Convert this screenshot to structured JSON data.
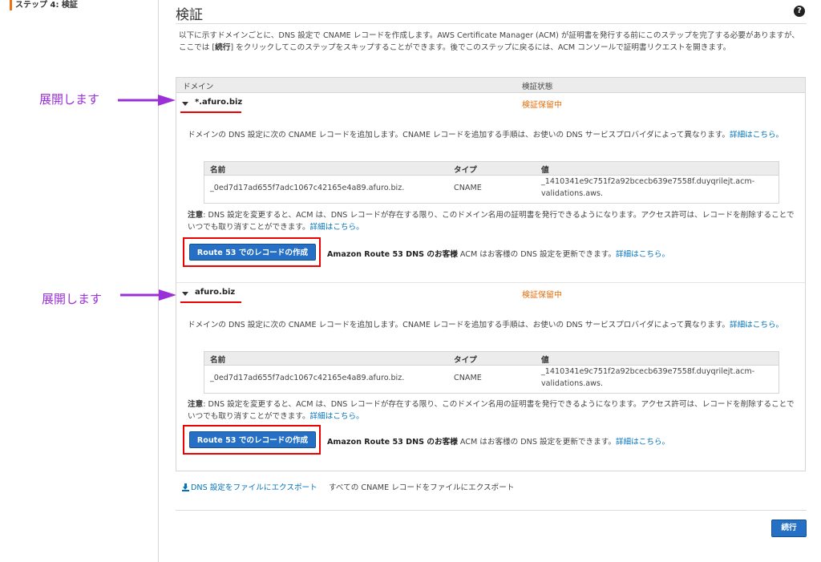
{
  "sidebar": {
    "step_label": "ステップ 4: 検証"
  },
  "header": {
    "title": "検証",
    "help_icon": "?"
  },
  "description": {
    "part1": "以下に示すドメインごとに、DNS 設定で CNAME レコードを作成します。AWS Certificate Manager (ACM) が証明書を発行する前にこのステップを完了する必要がありますが、ここでは [",
    "bold": "続行",
    "part2": "] をクリックしてこのステップをスキップすることができます。後でこのステップに戻るには、ACM コンソールで証明書リクエストを開きます。"
  },
  "table": {
    "col_domain": "ドメイン",
    "col_status": "検証状態"
  },
  "domains": [
    {
      "name": "*.afuro.biz",
      "status": "検証保留中",
      "instructions": "ドメインの DNS 設定に次の CNAME レコードを追加します。CNAME レコードを追加する手順は、お使いの DNS サービスプロバイダによって異なります。",
      "details_link": "詳細はこちら。",
      "record_headers": {
        "name": "名前",
        "type": "タイプ",
        "value": "値"
      },
      "record": {
        "name": "_0ed7d17ad655f7adc1067c42165e4a89.afuro.biz.",
        "type": "CNAME",
        "value_line1": "_1410341e9c751f2a92bcecb639e7558f.duyqrilejt.acm-",
        "value_line2": "validations.aws."
      },
      "note_label": "注意",
      "note_text": ": DNS 設定を変更すると、ACM は、DNS レコードが存在する限り、このドメイン名用の証明書を発行できるようになります。アクセス許可は、レコードを削除することでいつでも取り消すことができます。",
      "note_link": "詳細はこちら。",
      "button_label": "Route 53 でのレコードの作成",
      "r53_bold": "Amazon Route 53 DNS のお客様",
      "r53_text": " ACM はお客様の DNS 設定を更新できます。",
      "r53_link": "詳細はこちら。"
    },
    {
      "name": "afuro.biz",
      "status": "検証保留中",
      "instructions": "ドメインの DNS 設定に次の CNAME レコードを追加します。CNAME レコードを追加する手順は、お使いの DNS サービスプロバイダによって異なります。",
      "details_link": "詳細はこちら。",
      "record_headers": {
        "name": "名前",
        "type": "タイプ",
        "value": "値"
      },
      "record": {
        "name": "_0ed7d17ad655f7adc1067c42165e4a89.afuro.biz.",
        "type": "CNAME",
        "value_line1": "_1410341e9c751f2a92bcecb639e7558f.duyqrilejt.acm-",
        "value_line2": "validations.aws."
      },
      "note_label": "注意",
      "note_text": ": DNS 設定を変更すると、ACM は、DNS レコードが存在する限り、このドメイン名用の証明書を発行できるようになります。アクセス許可は、レコードを削除することでいつでも取り消すことができます。",
      "note_link": "詳細はこちら。",
      "button_label": "Route 53 でのレコードの作成",
      "r53_bold": "Amazon Route 53 DNS のお客様",
      "r53_text": " ACM はお客様の DNS 設定を更新できます。",
      "r53_link": "詳細はこちら。"
    }
  ],
  "export": {
    "dns_link": "DNS 設定をファイルにエクスポート",
    "cname_text": "すべての CNAME レコードをファイルにエクスポート"
  },
  "footer": {
    "continue_label": "続行"
  },
  "annotations": {
    "expand_label": "展開します"
  },
  "colors": {
    "accent": "#2570c4",
    "pending": "#e46c0a",
    "highlight": "#e00000",
    "annotation": "#9b30d9",
    "link": "#0073bb"
  }
}
